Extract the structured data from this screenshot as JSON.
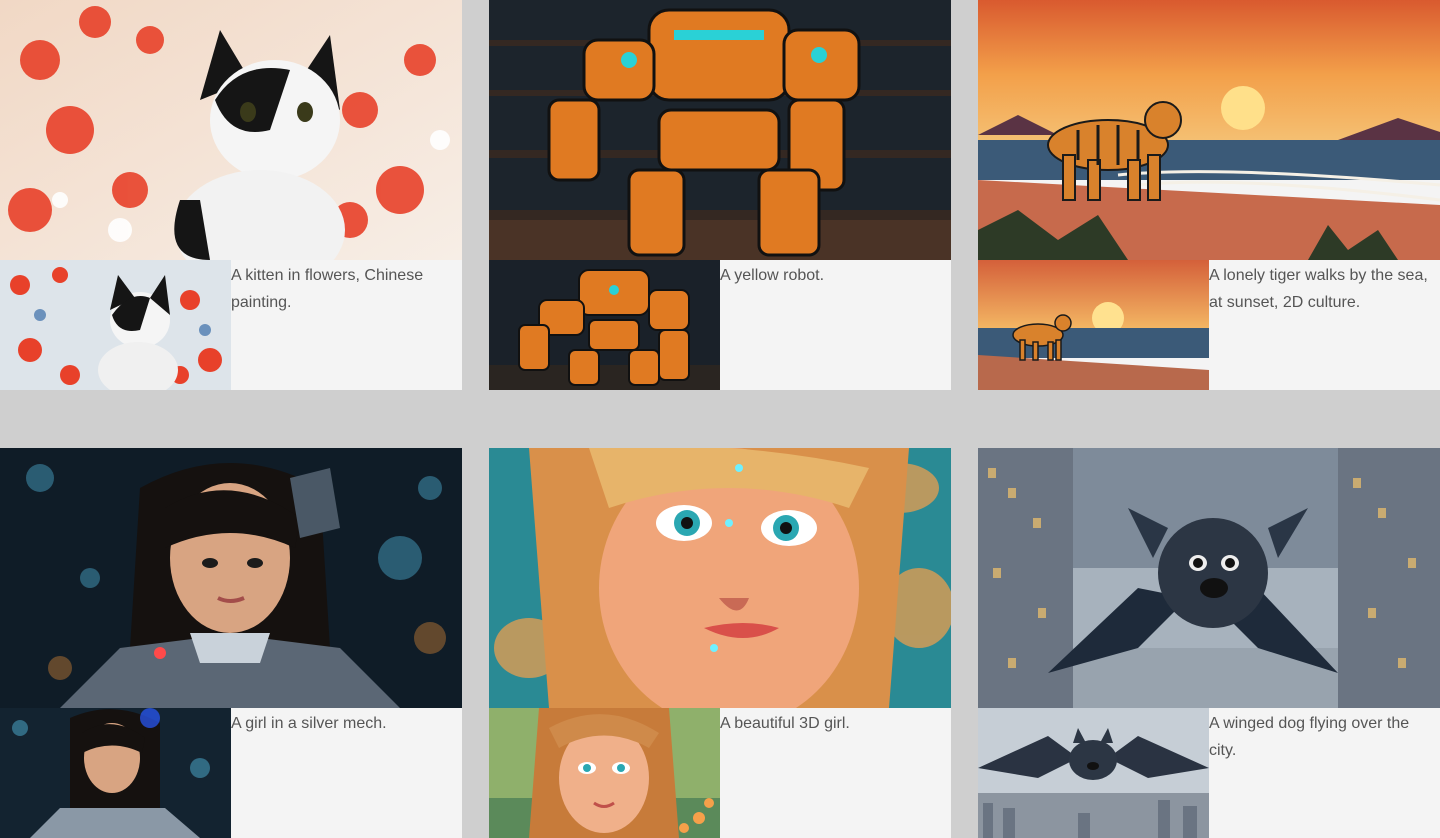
{
  "gallery": {
    "items": [
      {
        "caption": "A kitten in flowers, Chinese painting.",
        "hero_alt": "kitten",
        "palette": [
          "#f6e6d7",
          "#e8412a",
          "#1a1a1a",
          "#ffffff"
        ]
      },
      {
        "caption": "A yellow robot.",
        "hero_alt": "robot",
        "palette": [
          "#1a2530",
          "#e07a22",
          "#2ad1d6",
          "#0e1216"
        ]
      },
      {
        "caption": "A lonely tiger walks by the sea, at sunset, 2D culture.",
        "hero_alt": "tiger",
        "palette": [
          "#f08a3a",
          "#f3c06a",
          "#6a3a4a",
          "#2a2a2a"
        ]
      },
      {
        "caption": "A girl in a silver mech.",
        "hero_alt": "mech-girl",
        "palette": [
          "#0f1d28",
          "#3a4a58",
          "#c9d2da",
          "#5fd4ff"
        ]
      },
      {
        "caption": "A beautiful 3D girl.",
        "hero_alt": "3d-girl",
        "palette": [
          "#f0a057",
          "#2aa7b2",
          "#f6d07a",
          "#b5582a"
        ]
      },
      {
        "caption": "A winged dog flying over the city.",
        "hero_alt": "bat-dog",
        "palette": [
          "#8a97a6",
          "#1e2a3a",
          "#c8d2db",
          "#5b6a7c"
        ]
      }
    ]
  }
}
